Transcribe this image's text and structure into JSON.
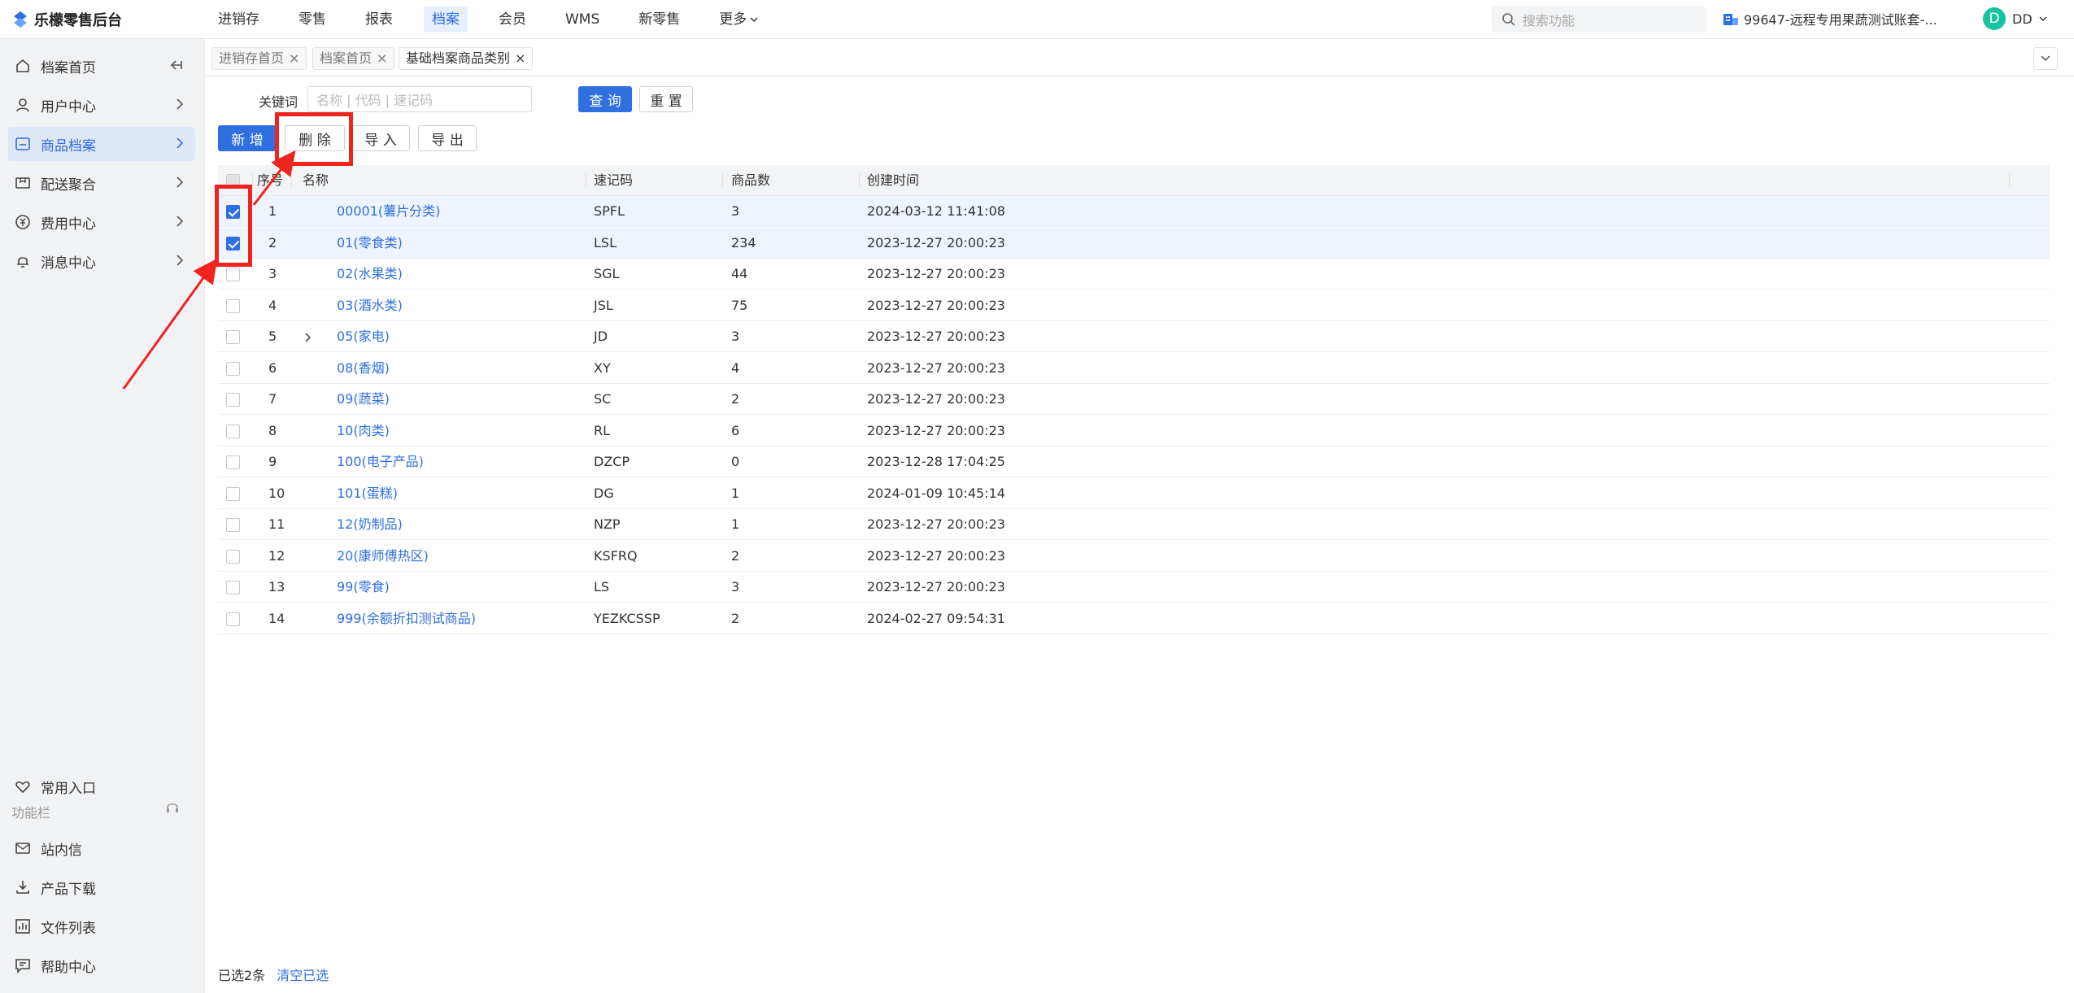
{
  "app": {
    "title": "乐檬零售后台"
  },
  "top_nav": [
    {
      "label": "进销存"
    },
    {
      "label": "零售"
    },
    {
      "label": "报表"
    },
    {
      "label": "档案",
      "active": true
    },
    {
      "label": "会员"
    },
    {
      "label": "WMS"
    },
    {
      "label": "新零售"
    },
    {
      "label": "更多"
    }
  ],
  "search": {
    "placeholder": "搜索功能"
  },
  "account": {
    "label": "99647-远程专用果蔬测试账套-..."
  },
  "user": {
    "initial": "D",
    "name": "DD"
  },
  "sidebar": {
    "items": [
      {
        "label": "档案首页"
      },
      {
        "label": "用户中心"
      },
      {
        "label": "商品档案",
        "active": true
      },
      {
        "label": "配送聚合"
      },
      {
        "label": "费用中心"
      },
      {
        "label": "消息中心"
      }
    ],
    "bottom": {
      "favorites": "常用入口",
      "section": "功能栏",
      "items": [
        {
          "label": "站内信"
        },
        {
          "label": "产品下载"
        },
        {
          "label": "文件列表"
        },
        {
          "label": "帮助中心"
        }
      ]
    }
  },
  "tabs": [
    {
      "label": "进销存首页"
    },
    {
      "label": "档案首页"
    },
    {
      "label": "基础档案商品类别",
      "active": true
    }
  ],
  "filter": {
    "keyword_label": "关键词",
    "keyword_placeholder": "名称 | 代码 | 速记码",
    "query": "查 询",
    "reset": "重 置"
  },
  "toolbar": {
    "add": "新 增",
    "delete": "删 除",
    "import": "导 入",
    "export": "导 出"
  },
  "table": {
    "headers": {
      "index": "序号",
      "name": "名称",
      "code": "速记码",
      "count": "商品数",
      "created": "创建时间"
    },
    "rows": [
      {
        "index": "1",
        "name": "00001(薯片分类)",
        "code": "SPFL",
        "count": "3",
        "created": "2024-03-12 11:41:08",
        "checked": true
      },
      {
        "index": "2",
        "name": "01(零食类)",
        "code": "LSL",
        "count": "234",
        "created": "2023-12-27 20:00:23",
        "checked": true
      },
      {
        "index": "3",
        "name": "02(水果类)",
        "code": "SGL",
        "count": "44",
        "created": "2023-12-27 20:00:23"
      },
      {
        "index": "4",
        "name": "03(酒水类)",
        "code": "JSL",
        "count": "75",
        "created": "2023-12-27 20:00:23"
      },
      {
        "index": "5",
        "name": "05(家电)",
        "code": "JD",
        "count": "3",
        "created": "2023-12-27 20:00:23",
        "expandable": true
      },
      {
        "index": "6",
        "name": "08(香烟)",
        "code": "XY",
        "count": "4",
        "created": "2023-12-27 20:00:23"
      },
      {
        "index": "7",
        "name": "09(蔬菜)",
        "code": "SC",
        "count": "2",
        "created": "2023-12-27 20:00:23"
      },
      {
        "index": "8",
        "name": "10(肉类)",
        "code": "RL",
        "count": "6",
        "created": "2023-12-27 20:00:23"
      },
      {
        "index": "9",
        "name": "100(电子产品)",
        "code": "DZCP",
        "count": "0",
        "created": "2023-12-28 17:04:25"
      },
      {
        "index": "10",
        "name": "101(蛋糕)",
        "code": "DG",
        "count": "1",
        "created": "2024-01-09 10:45:14"
      },
      {
        "index": "11",
        "name": "12(奶制品)",
        "code": "NZP",
        "count": "1",
        "created": "2023-12-27 20:00:23"
      },
      {
        "index": "12",
        "name": "20(康师傅热区)",
        "code": "KSFRQ",
        "count": "2",
        "created": "2023-12-27 20:00:23"
      },
      {
        "index": "13",
        "name": "99(零食)",
        "code": "LS",
        "count": "3",
        "created": "2023-12-27 20:00:23"
      },
      {
        "index": "14",
        "name": "999(余额折扣测试商品)",
        "code": "YEZKCSSP",
        "count": "2",
        "created": "2024-02-27 09:54:31"
      }
    ]
  },
  "footer": {
    "selected": "已选2条",
    "clear": "清空已选"
  },
  "colors": {
    "accent": "#2f6fdf",
    "annotation": "#f0231e"
  }
}
